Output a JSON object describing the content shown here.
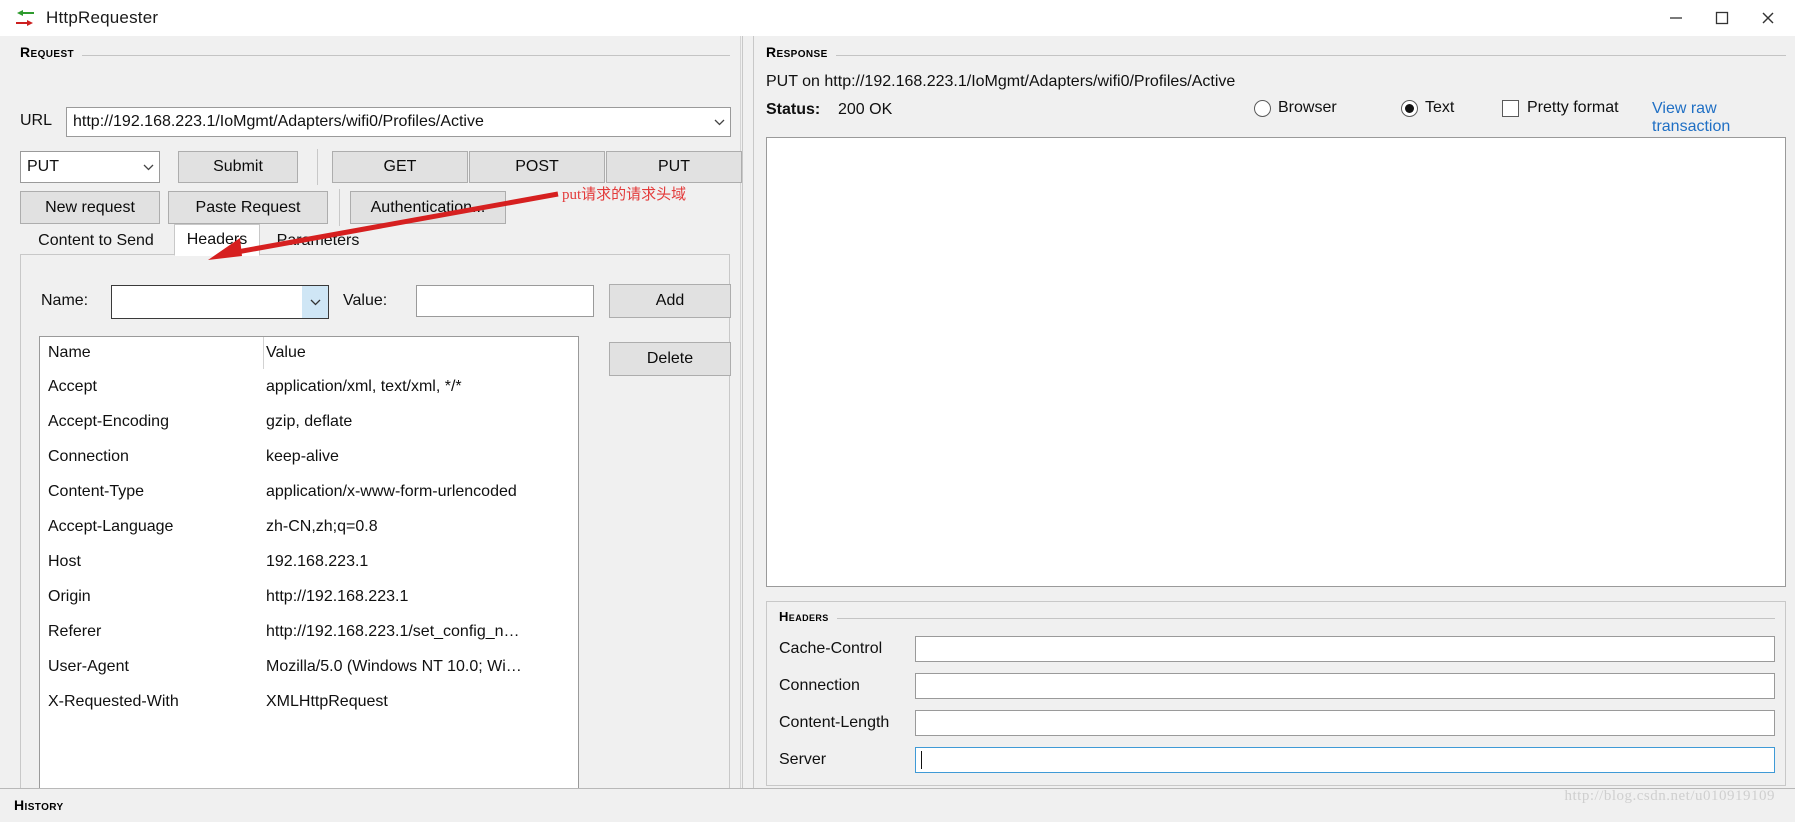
{
  "window": {
    "title": "HttpRequester",
    "icon": "http-arrows-icon",
    "minimize_label": "–",
    "maximize_label": "□",
    "close_label": "✕"
  },
  "request": {
    "section_label": "Request",
    "url_label": "URL",
    "url_value": "http://192.168.223.1/IoMgmt/Adapters/wifi0/Profiles/Active",
    "method_value": "PUT",
    "buttons": {
      "submit": "Submit",
      "get": "GET",
      "post": "POST",
      "put": "PUT",
      "new_request": "New request",
      "paste_request": "Paste Request",
      "authentication": "Authentication..."
    },
    "tabs": [
      {
        "label": "Content to Send",
        "active": false
      },
      {
        "label": "Headers",
        "active": true
      },
      {
        "label": "Parameters",
        "active": false
      }
    ],
    "header_editor": {
      "name_label": "Name:",
      "name_value": "",
      "value_label": "Value:",
      "value_value": "",
      "add_label": "Add",
      "delete_label": "Delete"
    },
    "headers_table": {
      "columns": [
        "Name",
        "Value"
      ],
      "rows": [
        {
          "name": "Accept",
          "value": "application/xml, text/xml, */*"
        },
        {
          "name": "Accept-Encoding",
          "value": "gzip, deflate"
        },
        {
          "name": "Connection",
          "value": "keep-alive"
        },
        {
          "name": "Content-Type",
          "value": "application/x-www-form-urlencoded"
        },
        {
          "name": "Accept-Language",
          "value": "zh-CN,zh;q=0.8"
        },
        {
          "name": "Host",
          "value": "192.168.223.1"
        },
        {
          "name": "Origin",
          "value": "http://192.168.223.1"
        },
        {
          "name": "Referer",
          "value": "http://192.168.223.1/set_config_n…"
        },
        {
          "name": "User-Agent",
          "value": "Mozilla/5.0 (Windows NT 10.0; Wi…"
        },
        {
          "name": "X-Requested-With",
          "value": "XMLHttpRequest"
        }
      ]
    }
  },
  "response": {
    "section_label": "Response",
    "summary": "PUT on http://192.168.223.1/IoMgmt/Adapters/wifi0/Profiles/Active",
    "status_label": "Status:",
    "status_value": "200 OK",
    "view_modes": [
      {
        "label": "Browser",
        "selected": false
      },
      {
        "label": "Text",
        "selected": true
      }
    ],
    "pretty_format_label": "Pretty format",
    "pretty_format_checked": false,
    "raw_link": "View raw transaction",
    "body_text": "",
    "headers": {
      "section_label": "Headers",
      "fields": [
        {
          "label": "Cache-Control",
          "value": "",
          "focused": false
        },
        {
          "label": "Connection",
          "value": "",
          "focused": false
        },
        {
          "label": "Content-Length",
          "value": "",
          "focused": false
        },
        {
          "label": "Server",
          "value": "",
          "focused": true
        }
      ]
    }
  },
  "history": {
    "section_label": "History"
  },
  "annotation": {
    "text": "put请求的请求头域",
    "color": "#e33a3a"
  },
  "watermark": {
    "text": "http://blog.csdn.net/u010919109"
  }
}
